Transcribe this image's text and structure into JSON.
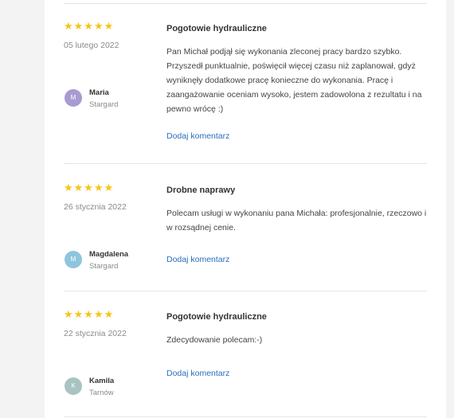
{
  "reviews": [
    {
      "stars": "★★★★★",
      "date": "05 lutego 2022",
      "initial": "M",
      "avatar_color": "#a89bd1",
      "name": "Maria",
      "city": "Stargard",
      "title": "Pogotowie hydrauliczne",
      "text": "Pan Michał podjął się wykonania zleconej pracy bardzo szybko. Przyszedł punktualnie, poświęcił więcej czasu niż zaplanował, gdyż wyniknęły dodatkowe pracę konieczne do wykonania. Pracę i zaangażowanie oceniam wysoko, jestem zadowolona z rezultatu i na pewno wrócę :)",
      "comment_label": "Dodaj komentarz"
    },
    {
      "stars": "★★★★★",
      "date": "26 stycznia 2022",
      "initial": "M",
      "avatar_color": "#8ec5dc",
      "name": "Magdalena",
      "city": "Stargard",
      "title": "Drobne naprawy",
      "text": "Polecam usługi w wykonaniu pana Michała: profesjonalnie, rzeczowo i w rozsądnej cenie.",
      "comment_label": "Dodaj komentarz"
    },
    {
      "stars": "★★★★★",
      "date": "22 stycznia 2022",
      "initial": "K",
      "avatar_color": "#a9c3c3",
      "name": "Kamila",
      "city": "Tarnów",
      "title": "Pogotowie hydrauliczne",
      "text": "Zdecydowanie polecam:-)",
      "comment_label": "Dodaj komentarz"
    }
  ]
}
